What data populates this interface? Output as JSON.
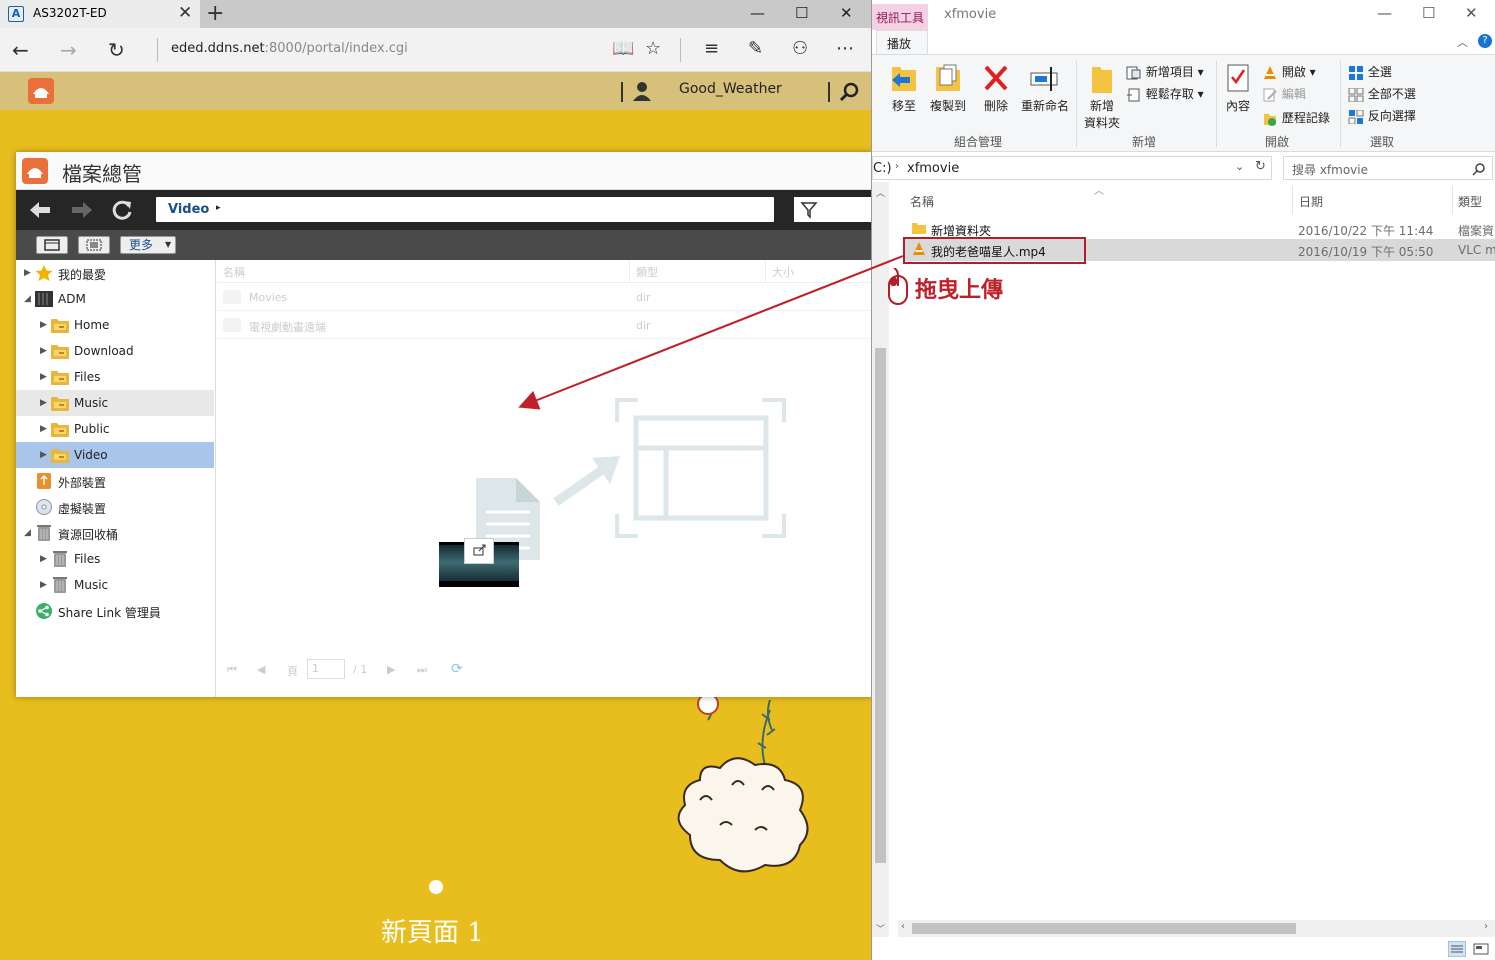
{
  "browser": {
    "tab_title": "AS3202T-ED",
    "url_host": "eded.ddns.net",
    "url_rest": ":8000/portal/index.cgi"
  },
  "adm": {
    "username": "Good_Weather"
  },
  "file_manager": {
    "title": "檔案總管",
    "path_segment": "Video",
    "more_label": "更多",
    "tree": [
      {
        "label": "我的最愛"
      },
      {
        "label": "ADM"
      },
      {
        "label": "Home"
      },
      {
        "label": "Download"
      },
      {
        "label": "Files"
      },
      {
        "label": "Music"
      },
      {
        "label": "Public"
      },
      {
        "label": "Video"
      },
      {
        "label": "外部裝置"
      },
      {
        "label": "虛擬裝置"
      },
      {
        "label": "資源回收桶"
      },
      {
        "label": "Files"
      },
      {
        "label": "Music"
      },
      {
        "label": "Share Link 管理員"
      }
    ],
    "list_headers": {
      "name": "名稱",
      "type": "類型",
      "size": "大小"
    },
    "rows": [
      {
        "name": "Movies",
        "type": "dir"
      },
      {
        "name": "電視劇動畫遠端",
        "type": "dir"
      }
    ],
    "pager": {
      "page_label": "頁",
      "page_value": "1",
      "total": "/ 1"
    }
  },
  "slideshow": {
    "caption": "新頁面 1"
  },
  "explorer": {
    "context_tab": "視訊工具",
    "window_title": "xfmovie",
    "ribbon_tab": "播放",
    "ribbon": {
      "move_to": "移至",
      "copy_to": "複製到",
      "delete": "刪除",
      "rename": "重新命名",
      "new_folder_l1": "新增",
      "new_folder_l2": "資料夾",
      "new_item": "新增項目",
      "easy_access": "輕鬆存取",
      "properties": "內容",
      "open": "開啟",
      "edit": "編輯",
      "history": "歷程記錄",
      "select_all": "全選",
      "select_none": "全部不選",
      "invert_selection": "反向選擇",
      "group_organize": "組合管理",
      "group_new": "新增",
      "group_open": "開啟",
      "group_select": "選取"
    },
    "address_prefix": "C:)",
    "address_folder": "xfmovie",
    "search_placeholder": "搜尋 xfmovie",
    "columns": {
      "name": "名稱",
      "date": "日期",
      "type": "類型"
    },
    "files": [
      {
        "name": "新增資料夾",
        "date": "2016/10/22 下午 11:44",
        "type": "檔案資"
      },
      {
        "name": "我的老爸喵星人.mp4",
        "date": "2016/10/19 下午 05:50",
        "type": "VLC m"
      }
    ]
  },
  "annotation": {
    "drag_text": "拖曳上傳"
  },
  "colors": {
    "adm_background": "#e8bd1e",
    "annotation_red": "#c0202a",
    "selection_blue": "#a9c6ea"
  }
}
